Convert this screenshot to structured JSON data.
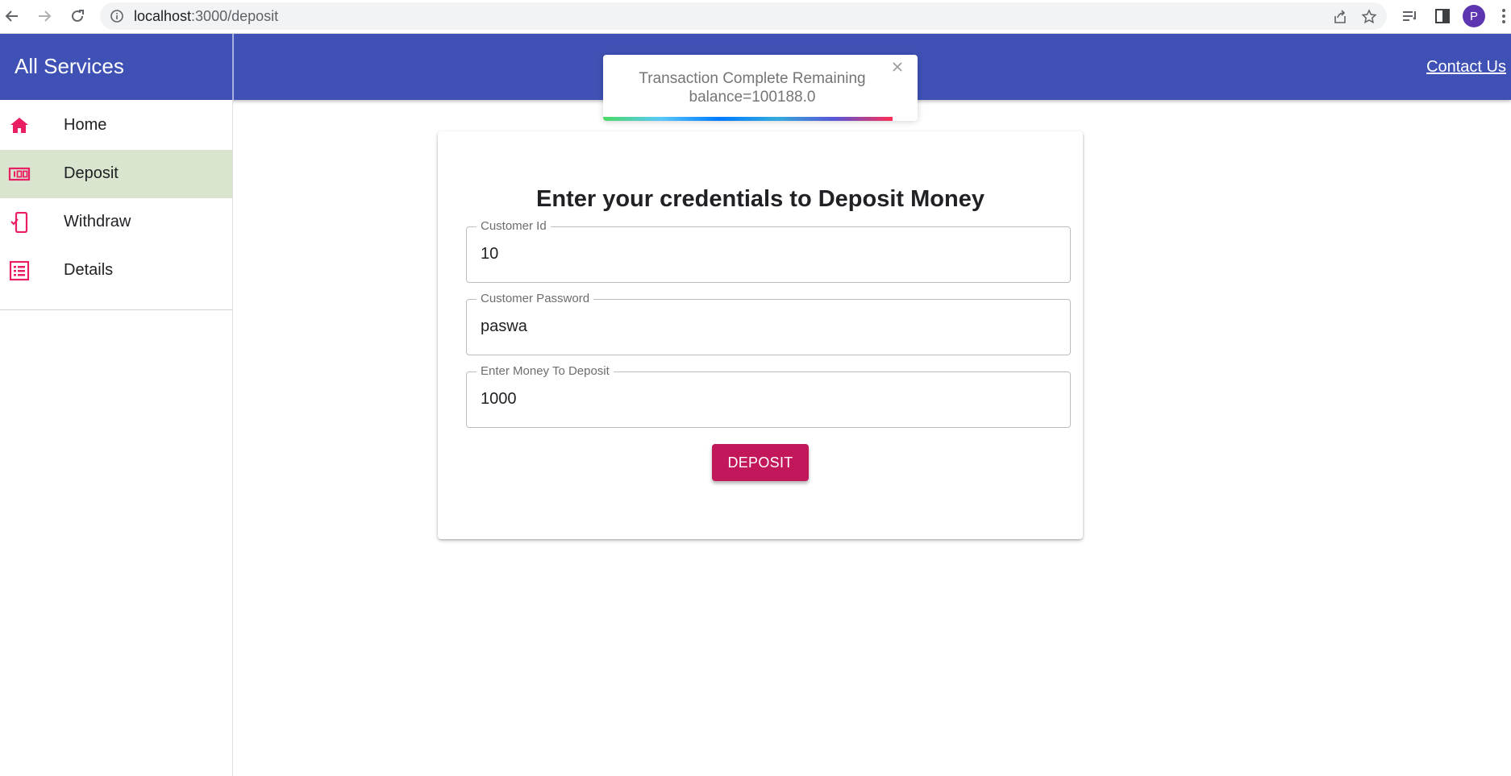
{
  "browser": {
    "url_host": "localhost",
    "url_path": ":3000/deposit",
    "profile_initial": "P"
  },
  "appbar": {
    "title": "All Services",
    "contact_label": "Contact Us"
  },
  "sidebar": {
    "items": [
      {
        "label": "Home",
        "icon": "home-icon",
        "active": false
      },
      {
        "label": "Deposit",
        "icon": "money-icon",
        "active": true
      },
      {
        "label": "Withdraw",
        "icon": "phone-check-icon",
        "active": false
      },
      {
        "label": "Details",
        "icon": "list-icon",
        "active": false
      }
    ]
  },
  "form": {
    "title": "Enter your credentials to Deposit Money",
    "fields": [
      {
        "label": "Customer Id",
        "value": "10"
      },
      {
        "label": "Customer Password",
        "value": "paswa"
      },
      {
        "label": "Enter Money To Deposit",
        "value": "1000"
      }
    ],
    "submit_label": "DEPOSIT"
  },
  "toast": {
    "message": "Transaction Complete Remaining balance=100188.0",
    "progress": 0.92
  },
  "colors": {
    "appbar": "#3f51b5",
    "accent": "#c2185b",
    "icon": "#e91e63",
    "active_nav": "#d9e5cf"
  }
}
